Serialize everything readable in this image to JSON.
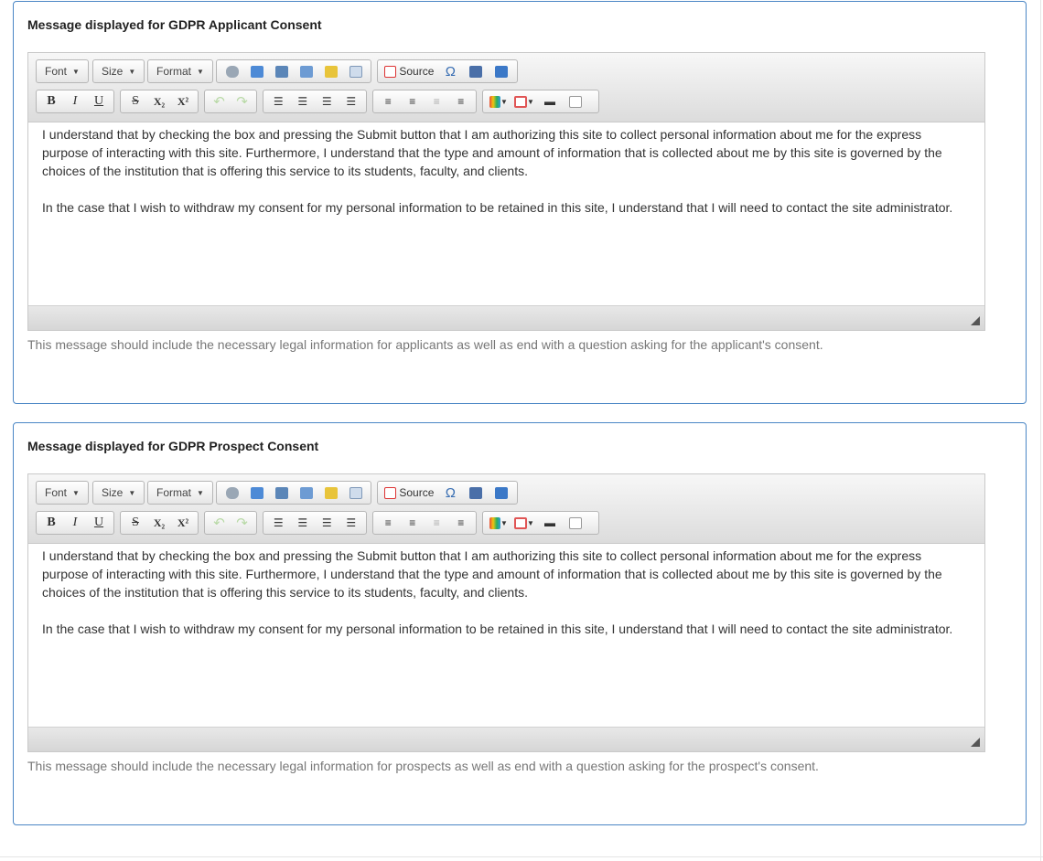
{
  "toolbar": {
    "font_label": "Font",
    "size_label": "Size",
    "format_label": "Format",
    "source_label": "Source",
    "bold": "B",
    "italic": "I",
    "underline": "U",
    "strike": "S",
    "subscript": "X₂",
    "superscript": "X²",
    "special_char": "Ω"
  },
  "panels": [
    {
      "title": "Message displayed for GDPR Applicant Consent",
      "paragraph1": "I understand that by checking the box and pressing the Submit button that I am authorizing this site to collect personal information about me for the express purpose of interacting with this site. Furthermore, I understand that the type and amount of information that is collected about me by this site is governed by the choices of the institution that is offering this service to its students, faculty, and clients.",
      "paragraph2": "In the case that I wish to withdraw my consent for my personal information to be retained in this site, I understand that I will need to contact the site administrator.",
      "help": "This message should include the necessary legal information for applicants as well as end with a question asking for the applicant's consent."
    },
    {
      "title": "Message displayed for GDPR Prospect Consent",
      "paragraph1": "I understand that by checking the box and pressing the Submit button that I am authorizing this site to collect personal information about me for the express purpose of interacting with this site. Furthermore, I understand that the type and amount of information that is collected about me by this site is governed by the choices of the institution that is offering this service to its students, faculty, and clients.",
      "paragraph2": "In the case that I wish to withdraw my consent for my personal information to be retained in this site, I understand that I will need to contact the site administrator.",
      "help": "This message should include the necessary legal information for prospects as well as end with a question asking for the prospect's consent."
    }
  ]
}
